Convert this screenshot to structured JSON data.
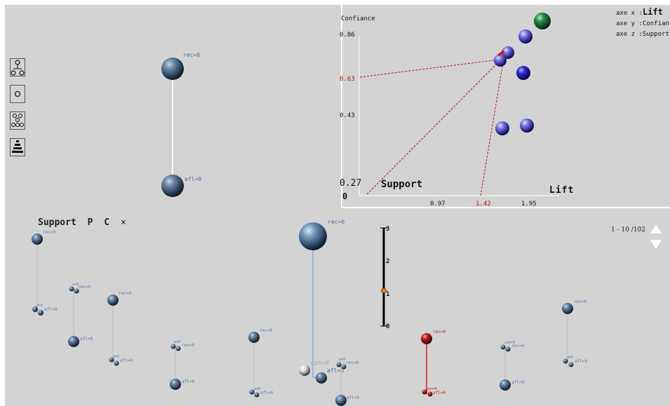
{
  "main_rule": {
    "top_label": "rec=0",
    "bottom_label": "afl=0"
  },
  "axis_legend": {
    "x_prefix": "axe x :",
    "x_value": "Lift",
    "y_line": "axe y :Confiance",
    "z_line": "axe z :Support"
  },
  "scatter3d": {
    "y_axis_title": "Confiance",
    "y_ticks": [
      "0.86",
      "0.63",
      "0.43",
      "0.27"
    ],
    "y_highlight_tick": "0.63",
    "x_ticks": [
      "0.97",
      "1.42",
      "1.95"
    ],
    "x_highlight_tick": "1.42",
    "origin_label": "0",
    "z_axis_title": "Support",
    "x_axis_title": "Lift",
    "colors": {
      "point": "#6b66d8",
      "highlight": "#d01010",
      "green": "#1f7a3a",
      "dark_blue": "#2a2ab5"
    }
  },
  "pc_toolbar": {
    "label": "Support",
    "p": "P",
    "c": "C",
    "close": "×"
  },
  "slider": {
    "labels": [
      "3",
      "2",
      "1",
      "0"
    ],
    "value": 1
  },
  "pager": {
    "text": "1 - 10 /102"
  },
  "rules": {
    "rec": "rec=0",
    "afl": "afl=0",
    "con": "con=0",
    "small": "a=0"
  }
}
